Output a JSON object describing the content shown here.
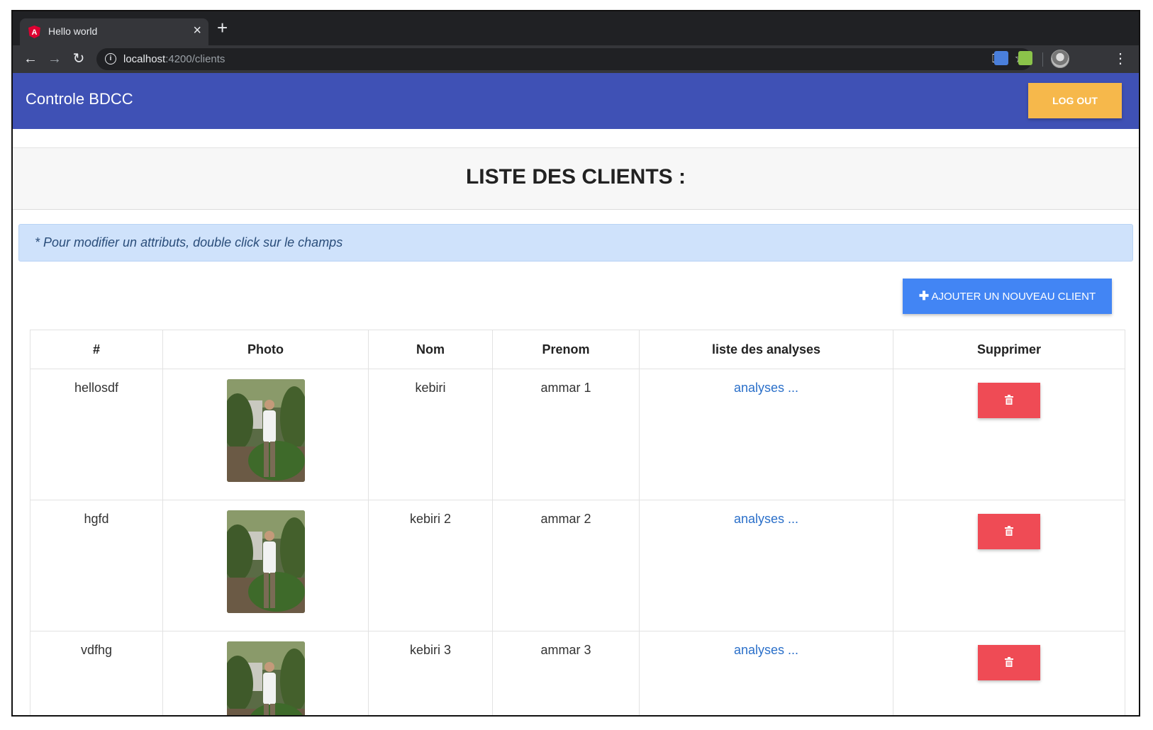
{
  "browser": {
    "tab_title": "Hello world",
    "url_host": "localhost",
    "url_rest": ":4200/clients"
  },
  "app": {
    "brand": "Controle BDCC",
    "logout_label": "LOG OUT"
  },
  "page": {
    "title": "LISTE DES CLIENTS :",
    "hint": "* Pour modifier un attributs, double click sur le champs",
    "add_button_label": "AJOUTER UN NOUVEAU CLIENT"
  },
  "table": {
    "columns": [
      "#",
      "Photo",
      "Nom",
      "Prenom",
      "liste des analyses",
      "Supprimer"
    ],
    "rows": [
      {
        "id": "hellosdf",
        "nom": "kebiri",
        "prenom": "ammar 1",
        "analyses": "analyses ..."
      },
      {
        "id": "hgfd",
        "nom": "kebiri 2",
        "prenom": "ammar 2",
        "analyses": "analyses ..."
      },
      {
        "id": "vdfhg",
        "nom": "kebiri 3",
        "prenom": "ammar 3",
        "analyses": "analyses ..."
      }
    ]
  },
  "colors": {
    "appbar": "#3f51b5",
    "logout": "#f6b84b",
    "add_button": "#4285f4",
    "delete_button": "#ef4b55",
    "hint_bg": "#cfe2fb"
  }
}
